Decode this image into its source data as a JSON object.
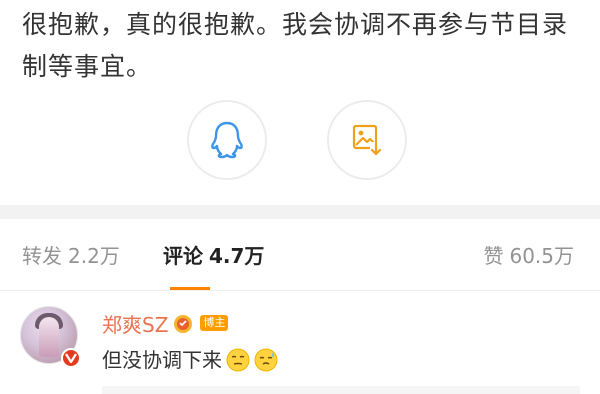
{
  "post": {
    "text": "很抱歉，真的很抱歉。我会协调不再参与节目录制等事宜。"
  },
  "share": {
    "qq_icon": "qq-penguin-icon",
    "save_icon": "save-image-icon"
  },
  "stats": {
    "repost_label": "转发",
    "repost_count": "2.2万",
    "comment_label": "评论",
    "comment_count": "4.7万",
    "like_label": "赞",
    "like_count": "60.5万",
    "active_tab_color": "#ff8200"
  },
  "comment": {
    "username": "郑爽SZ",
    "badge": "博主",
    "text": "但没协调下来",
    "username_color": "#eb7350",
    "verified_color": "#e33b1f",
    "emoji_icons": [
      "smirk-emoji-icon",
      "sweat-emoji-icon"
    ]
  }
}
